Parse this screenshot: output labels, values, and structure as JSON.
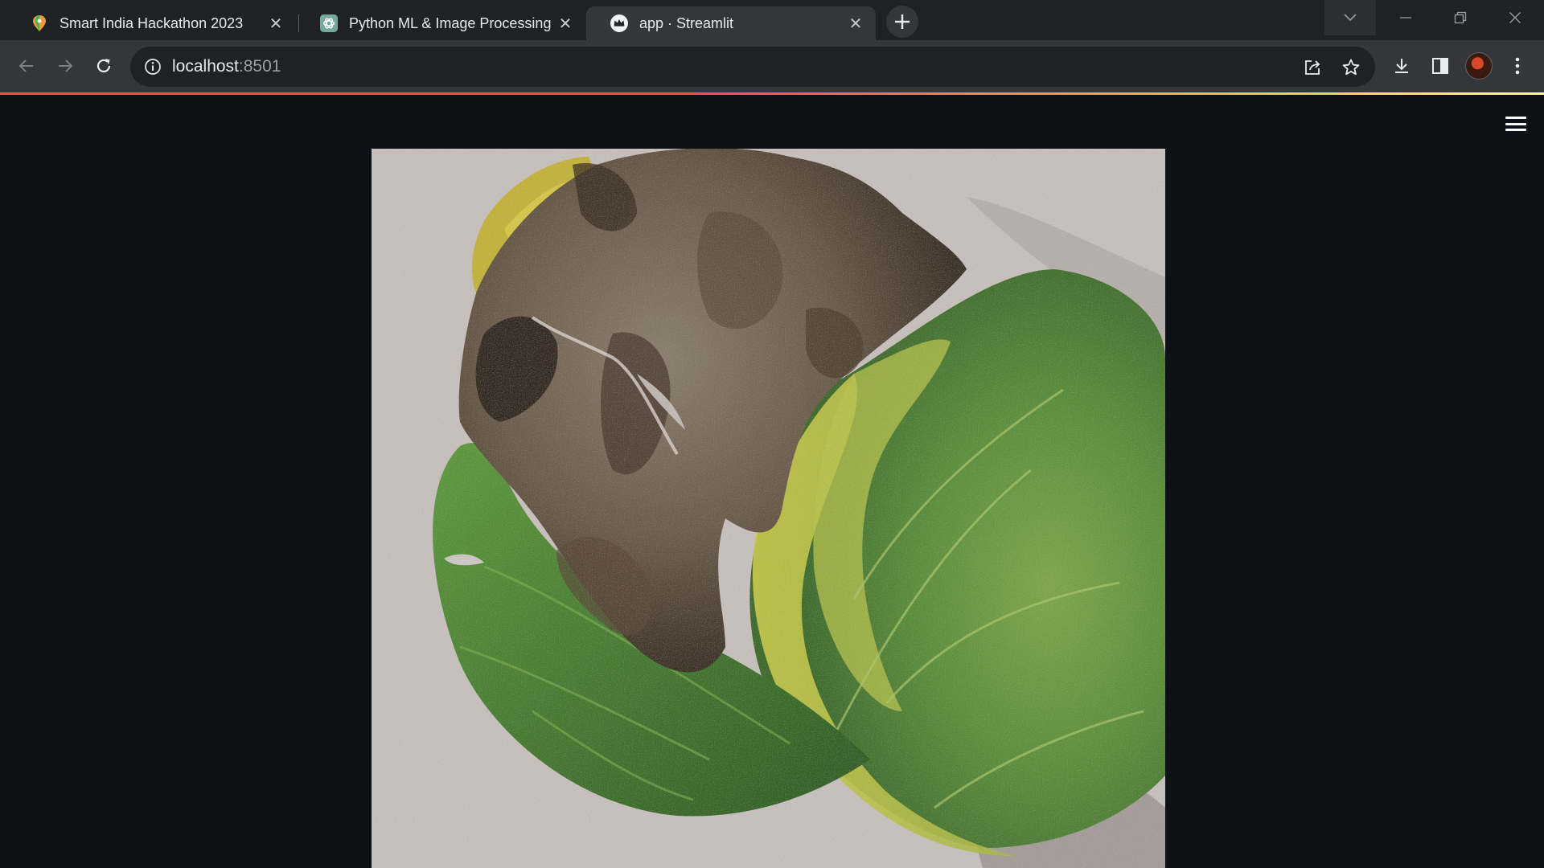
{
  "browser": {
    "tabs": [
      {
        "title": "Smart India Hackathon 2023",
        "favicon": "hackathon-pin-icon",
        "active": false
      },
      {
        "title": "Python ML & Image Processing",
        "favicon": "chatgpt-icon",
        "active": false
      },
      {
        "title": "app · Streamlit",
        "favicon": "streamlit-crown-icon",
        "active": true
      }
    ],
    "address": {
      "host": "localhost",
      "port": ":8501"
    },
    "colors": {
      "tabstrip": "#202124",
      "toolbar": "#35363a",
      "omnibox": "#202124",
      "loading_bar": "#ff4b4b"
    }
  },
  "app": {
    "background": "#0e1117",
    "menu_icon": "hamburger-menu-icon",
    "image": {
      "subject": "leaf-photo"
    }
  }
}
